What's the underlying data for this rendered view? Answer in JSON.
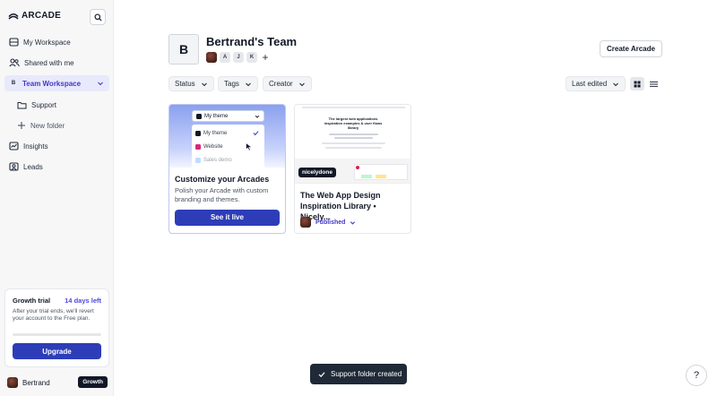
{
  "app": {
    "logo_text": "ARCADE",
    "accent_color": "#2d3db8"
  },
  "sidebar": {
    "items": [
      {
        "label": "My Workspace",
        "icon": "workspace-icon"
      },
      {
        "label": "Shared with me",
        "icon": "users-icon"
      },
      {
        "label": "Team Workspace",
        "badge": "B",
        "active": true
      },
      {
        "label": "Support",
        "icon": "folder-icon"
      },
      {
        "label": "New folder",
        "icon": "plus-icon"
      },
      {
        "label": "Insights",
        "icon": "chart-icon"
      },
      {
        "label": "Leads",
        "icon": "leads-icon"
      }
    ],
    "trial": {
      "title": "Growth trial",
      "days_left": "14 days left",
      "description": "After your trial ends, we'll revert your account to the Free plan.",
      "upgrade_label": "Upgrade"
    },
    "user": {
      "name": "Bertrand",
      "plan": "Growth"
    }
  },
  "header": {
    "avatar_letter": "B",
    "title": "Bertrand's Team",
    "members": [
      "A",
      "J",
      "K"
    ],
    "create_label": "Create Arcade"
  },
  "filters": {
    "status": "Status",
    "tags": "Tags",
    "creator": "Creator",
    "sort": "Last edited"
  },
  "promo_card": {
    "selected_theme": "My theme",
    "themes": [
      "My theme",
      "Website",
      "Sales demo"
    ],
    "title": "Customize your Arcades",
    "description": "Polish your Arcade with custom branding and themes.",
    "cta": "See it live"
  },
  "arcade_card": {
    "thumb_text": "The largest web applications inspiration examples & user flows library",
    "creator_tag": "nicelydone",
    "title": "The Web App Design Inspiration Library • Nicely...",
    "status": "Published"
  },
  "toast": {
    "message": "Support folder created"
  },
  "help": {
    "label": "?"
  }
}
